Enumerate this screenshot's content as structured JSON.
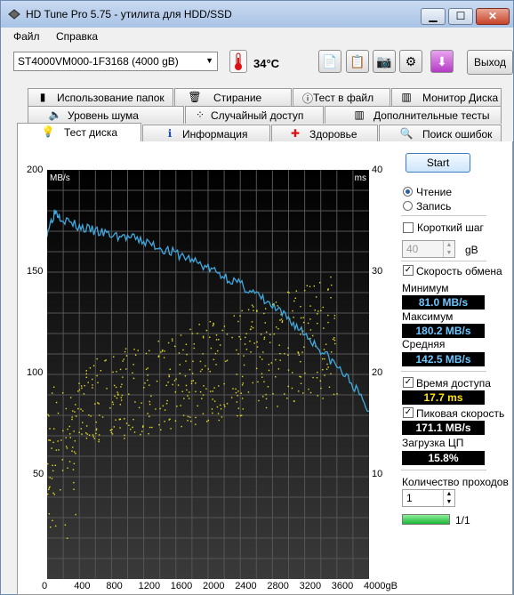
{
  "window": {
    "title": "HD Tune Pro 5.75 - утилита для HDD/SSD"
  },
  "menu": {
    "file": "Файл",
    "help": "Справка"
  },
  "toolbar": {
    "drive": "ST4000VM000-1F3168 (4000 gB)",
    "temperature": "34°C",
    "exit_label": "Выход"
  },
  "tabs": {
    "row1": [
      "Использование папок",
      "Стирание",
      "Тест в файл",
      "Монитор Диска"
    ],
    "row2": [
      "Уровень шума",
      "Случайный доступ",
      "Дополнительные  тесты"
    ],
    "row3": [
      "Тест диска",
      "Информация",
      "Здоровье",
      "Поиск ошибок"
    ],
    "active": "Тест диска"
  },
  "chart_data": {
    "type": "line",
    "ylabel_left": "MB/s",
    "ylabel_right": "ms",
    "ylim_left": [
      0,
      200
    ],
    "ylim_right": [
      0,
      40
    ],
    "xlim": [
      0,
      4000
    ],
    "xunit": "gB",
    "left_ticks": [
      "200",
      "150",
      "100",
      "50"
    ],
    "right_ticks": [
      "40",
      "30",
      "20",
      "10"
    ],
    "x_ticks": [
      "0",
      "400",
      "800",
      "1200",
      "1600",
      "2000",
      "2400",
      "2800",
      "3200",
      "3600",
      "4000gB"
    ],
    "grid": true,
    "series": [
      {
        "name": "transfer",
        "axis": "left",
        "color": "#3fa9e0",
        "x": [
          0,
          100,
          200,
          400,
          600,
          800,
          1000,
          1200,
          1400,
          1600,
          1800,
          2000,
          2200,
          2400,
          2600,
          2800,
          3000,
          3200,
          3400,
          3600,
          3800,
          4000
        ],
        "y": [
          170,
          180,
          176,
          172,
          170,
          168,
          167,
          165,
          162,
          159,
          156,
          152,
          148,
          144,
          139,
          133,
          127,
          120,
          112,
          104,
          95,
          82
        ]
      }
    ],
    "access_time_scatter": {
      "axis": "right",
      "color": "#e8e020",
      "range_ms_at_start": [
        12,
        20
      ],
      "range_ms_at_end": [
        18,
        30
      ]
    }
  },
  "controls": {
    "start_label": "Start",
    "read_label": "Чтение",
    "write_label": "Запись",
    "short_step_label": "Короткий шаг",
    "short_step_value": "40",
    "short_step_unit": "gB",
    "transfer_rate_label": "Скорость обмена",
    "min_label": "Минимум",
    "min_value": "81.0 MB/s",
    "max_label": "Максимум",
    "max_value": "180.2 MB/s",
    "avg_label": "Средняя",
    "avg_value": "142.5 MB/s",
    "access_time_label": "Время доступа",
    "access_time_value": "17.7 ms",
    "burst_label": "Пиковая скорость",
    "burst_value": "171.1 MB/s",
    "cpu_label": "Загрузка ЦП",
    "cpu_value": "15.8%",
    "passes_label": "Количество проходов",
    "passes_value": "1",
    "progress_text": "1/1",
    "progress_fraction": 1.0
  }
}
